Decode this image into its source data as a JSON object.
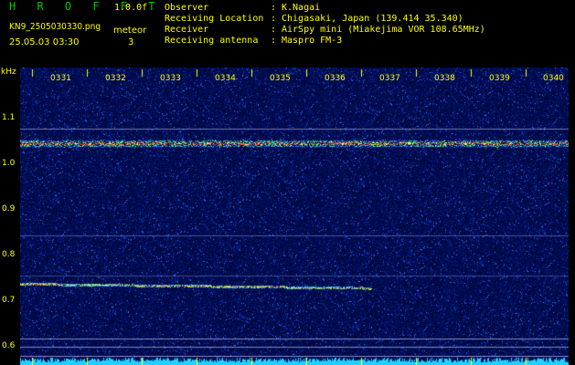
{
  "header": {
    "app_title": "H R O F F T",
    "version": "1.0.0f",
    "filename": "KN9_2505030330.png",
    "detector": "meteor",
    "timestamp": "25.05.03 03:30",
    "count": "3",
    "meta": [
      {
        "label": "Observer",
        "value": "K.Nagai"
      },
      {
        "label": "Receiving Location",
        "value": "Chigasaki, Japan (139.414 35.340)"
      },
      {
        "label": "Receiver",
        "value": "AirSpy mini (Miakejima VOR 108.65MHz)"
      },
      {
        "label": "Receiving antenna",
        "value": "Maspro FM-3"
      }
    ]
  },
  "axis": {
    "unit_label": "kHz",
    "y_ticks": [
      "1.1",
      "1.0",
      "0.9",
      "0.8",
      "0.7",
      "0.6"
    ],
    "x_ticks": [
      "0331",
      "0332",
      "0333",
      "0334",
      "0335",
      "0336",
      "0337",
      "0338",
      "0339",
      "0340"
    ]
  },
  "colors": {
    "background": "#000000",
    "plot_bg": "#000840",
    "text": "#ffff00",
    "title": "#00c800"
  }
}
